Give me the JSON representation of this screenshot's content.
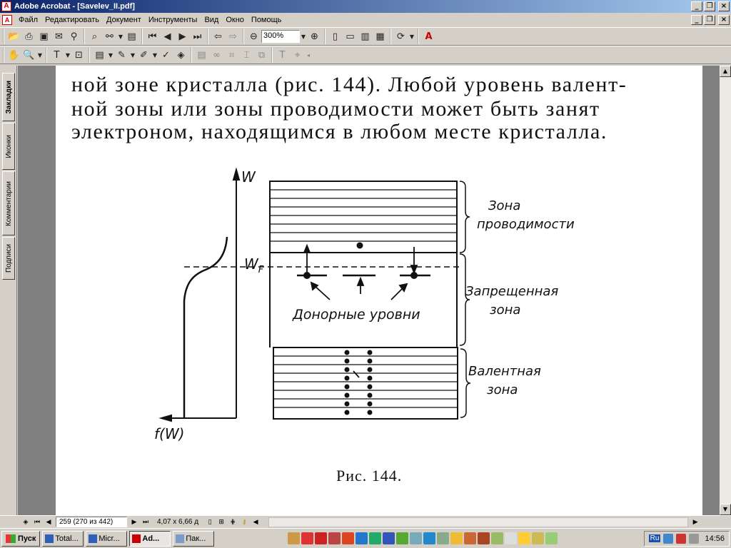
{
  "window": {
    "title": "Adobe Acrobat - [Savelev_II.pdf]"
  },
  "menu": {
    "items": [
      "Файл",
      "Редактировать",
      "Документ",
      "Инструменты",
      "Вид",
      "Окно",
      "Помощь"
    ]
  },
  "toolbar": {
    "zoom_value": "300%",
    "row1_icons": [
      "open-icon",
      "print-icon",
      "save-icon",
      "email-icon",
      "search-icon",
      "find-icon",
      "page-icon",
      "first-page-icon",
      "prev-page-icon",
      "next-page-icon",
      "last-page-icon",
      "back-icon",
      "forward-icon",
      "zoom-out-icon",
      "zoom-in-icon",
      "actual-size-icon",
      "fit-page-icon",
      "fit-width-icon",
      "reflow-icon",
      "rotate-icon",
      "adobe-logo"
    ],
    "row2_icons": [
      "hand-icon",
      "zoom-tool-icon",
      "text-select-icon",
      "snapshot-icon",
      "note-icon",
      "pencil-icon",
      "highlight-icon",
      "spellcheck-icon",
      "stamp-icon",
      "form-icon",
      "link-icon",
      "crop-icon",
      "touchup-icon",
      "text-tool-icon",
      "object-tool-icon"
    ]
  },
  "side_tabs": [
    "Закладки",
    "Иконки",
    "Комментарии",
    "Подписи"
  ],
  "document": {
    "text_lines": [
      "ной зоне кристалла (рис. 144). Любой уровень валент-",
      "ной зоны или зоны проводимости может быть занят",
      "электроном, находящимся в любом месте кристалла."
    ],
    "figure": {
      "axis_w": "W",
      "axis_fw": "f(W)",
      "fermi_label": "W",
      "fermi_sub": "F",
      "zone_conduction": [
        "Зона",
        "проводимости"
      ],
      "zone_forbidden": [
        "Запрещенная",
        "зона"
      ],
      "zone_valence": [
        "Валентная",
        "зона"
      ],
      "donor_label": "Донорные уровни"
    },
    "caption": "Рис. 144."
  },
  "statusbar": {
    "page_field": "259  (270 из 442)",
    "page_size": "4,07 x 6,66 д"
  },
  "taskbar": {
    "start_label": "Пуск",
    "tasks": [
      {
        "label": "Total...",
        "active": false
      },
      {
        "label": "Micr...",
        "active": false
      },
      {
        "label": "Ad...",
        "active": true
      },
      {
        "label": "Пак...",
        "active": false
      }
    ],
    "lang": "Ru",
    "clock": "14:56"
  }
}
